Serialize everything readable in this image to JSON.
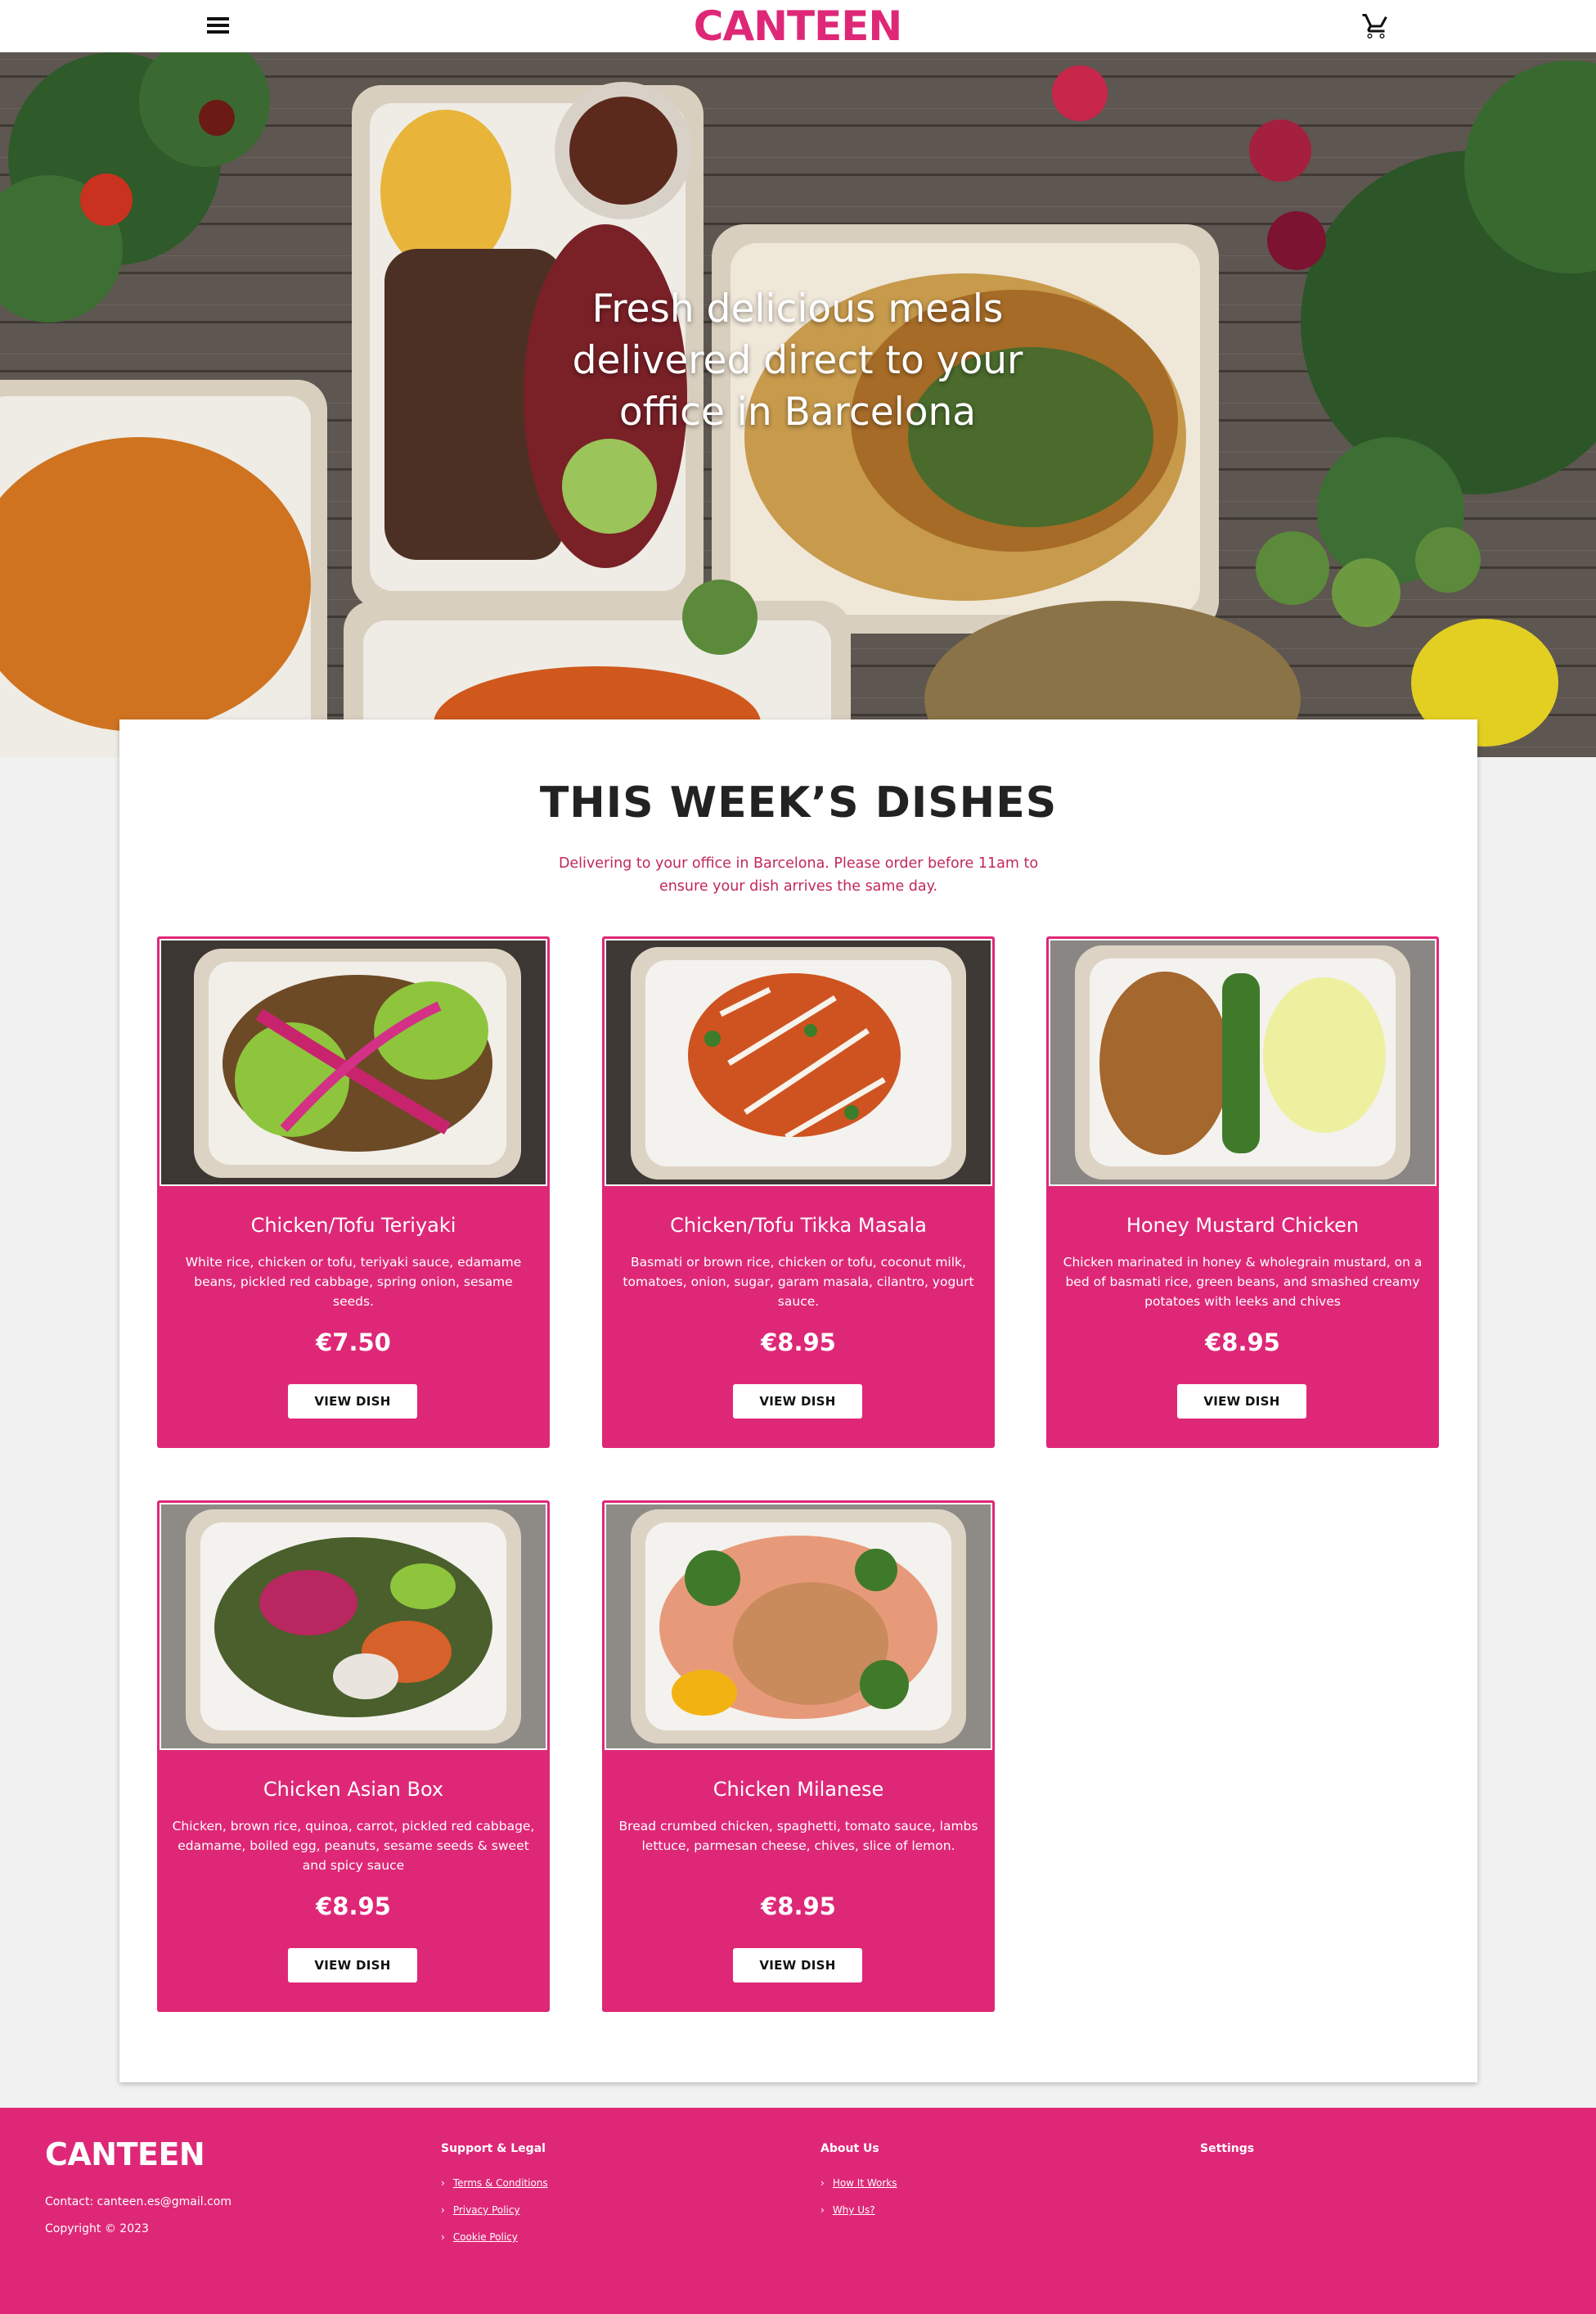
{
  "header": {
    "logo": "CANTEEN",
    "menu_icon": "hamburger-menu-icon",
    "cart_icon": "shopping-cart-icon"
  },
  "hero": {
    "title": "Fresh delicious meals\ndelivered direct to your\noffice in Barcelona"
  },
  "section": {
    "title": "THIS WEEK’S DISHES",
    "subtitle": "Delivering to your office in Barcelona. Please order before 11am to ensure your dish arrives the same day."
  },
  "dishes": [
    {
      "name": "Chicken/Tofu Teriyaki",
      "description": "White rice, chicken or tofu, teriyaki sauce, edamame beans, pickled red cabbage, spring onion, sesame seeds.",
      "price": "€7.50",
      "button": "VIEW DISH"
    },
    {
      "name": "Chicken/Tofu Tikka Masala",
      "description": "Basmati or brown rice, chicken or tofu, coconut milk, tomatoes, onion, sugar, garam masala, cilantro, yogurt sauce.",
      "price": "€8.95",
      "button": "VIEW DISH"
    },
    {
      "name": "Honey Mustard Chicken",
      "description": "Chicken marinated in honey & wholegrain mustard, on a bed of basmati rice, green beans, and smashed creamy potatoes with leeks and chives",
      "price": "€8.95",
      "button": "VIEW DISH"
    },
    {
      "name": "Chicken Asian Box",
      "description": "Chicken, brown rice, quinoa, carrot, pickled red cabbage, edamame, boiled egg, peanuts, sesame seeds & sweet and spicy sauce",
      "price": "€8.95",
      "button": "VIEW DISH"
    },
    {
      "name": "Chicken Milanese",
      "description": "Bread crumbed chicken, spaghetti, tomato sauce, lambs lettuce, parmesan cheese, chives, slice of lemon.",
      "price": "€8.95",
      "button": "VIEW DISH"
    }
  ],
  "footer": {
    "logo": "CANTEEN",
    "contact": "Contact: canteen.es@gmail.com",
    "copyright": "Copyright © 2023",
    "support": {
      "title": "Support & Legal",
      "links": [
        "Terms & Conditions",
        "Privacy Policy",
        "Cookie Policy"
      ]
    },
    "about": {
      "title": "About Us",
      "links": [
        "How It Works",
        "Why Us?"
      ]
    },
    "settings": {
      "title": "Settings"
    }
  },
  "colors": {
    "brand": "#de2877",
    "subtitle": "#c1275f"
  }
}
